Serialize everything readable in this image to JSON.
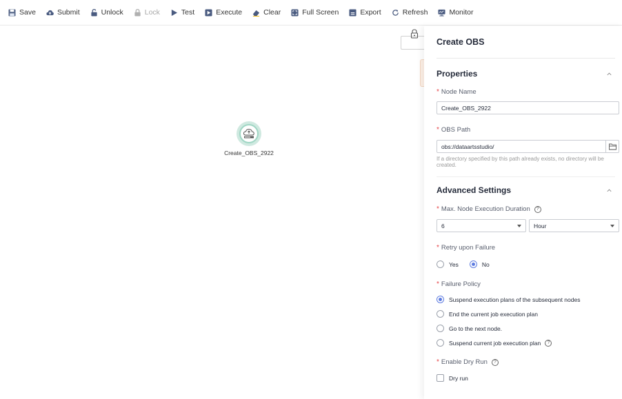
{
  "toolbar": {
    "save": "Save",
    "submit": "Submit",
    "unlock": "Unlock",
    "lock": "Lock",
    "test": "Test",
    "execute": "Execute",
    "clear": "Clear",
    "full_screen": "Full Screen",
    "export": "Export",
    "refresh": "Refresh",
    "monitor": "Monitor"
  },
  "canvas": {
    "node_label": "Create_OBS_2922"
  },
  "panel": {
    "title": "Create OBS",
    "properties": {
      "heading": "Properties",
      "node_name_label": "Node Name",
      "node_name_value": "Create_OBS_2922",
      "obs_path_label": "OBS Path",
      "obs_path_value": "obs://dataartsstudio/",
      "obs_path_hint": "If a directory specified by this path already exists, no directory will be created."
    },
    "advanced": {
      "heading": "Advanced Settings",
      "max_duration_label": "Max. Node Execution Duration",
      "duration_value": "6",
      "duration_unit": "Hour",
      "retry_label": "Retry upon Failure",
      "retry_yes": "Yes",
      "retry_no": "No",
      "retry_selected": "No",
      "failure_policy_label": "Failure Policy",
      "failure_policy_options": [
        "Suspend execution plans of the subsequent nodes",
        "End the current job execution plan",
        "Go to the next node.",
        "Suspend current job execution plan"
      ],
      "failure_policy_selected": "Suspend execution plans of the subsequent nodes",
      "dry_run_label": "Enable Dry Run",
      "dry_run_option": "Dry run",
      "dry_run_checked": false
    }
  },
  "colors": {
    "accent": "#5e7ce0",
    "required": "#e6464a",
    "node_ring": "#9fd6c4"
  }
}
